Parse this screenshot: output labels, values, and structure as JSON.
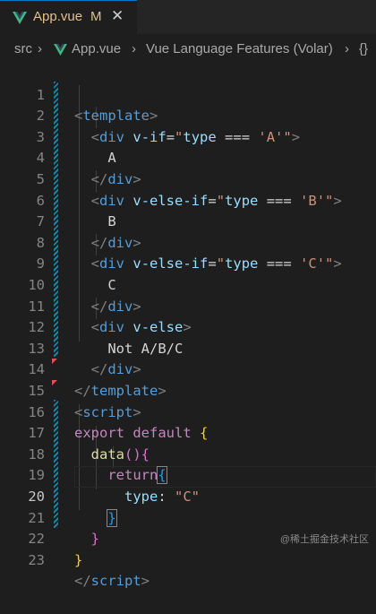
{
  "tab": {
    "title": "App.vue",
    "modified": "M",
    "close": "✕"
  },
  "breadcrumb": {
    "folder": "src",
    "file": "App.vue",
    "provider": "Vue Language Features (Volar)",
    "symbol": "{}"
  },
  "lines": [
    {
      "n": "1"
    },
    {
      "n": "2"
    },
    {
      "n": "3"
    },
    {
      "n": "4"
    },
    {
      "n": "5"
    },
    {
      "n": "6"
    },
    {
      "n": "7"
    },
    {
      "n": "8"
    },
    {
      "n": "9"
    },
    {
      "n": "10"
    },
    {
      "n": "11"
    },
    {
      "n": "12"
    },
    {
      "n": "13"
    },
    {
      "n": "14"
    },
    {
      "n": "15"
    },
    {
      "n": "16"
    },
    {
      "n": "17"
    },
    {
      "n": "18"
    },
    {
      "n": "19"
    },
    {
      "n": "20"
    },
    {
      "n": "21"
    },
    {
      "n": "22"
    },
    {
      "n": "23"
    }
  ],
  "code": {
    "l1": "template",
    "div": "div",
    "vif": "v-if",
    "velseif": "v-else-if",
    "velse": "v-else",
    "type": "type",
    "eq": " === ",
    "a": "'A'",
    "b": "'B'",
    "c": "'C'",
    "textA": "A",
    "textB": "B",
    "textC": "C",
    "textNot": "Not A/B/C",
    "script": "script",
    "export": "export",
    "default": "default",
    "data": "data",
    "return": "return",
    "typeKey": "type",
    "typeVal": "\"C\""
  },
  "watermark": "@稀土掘金技术社区",
  "colors": {
    "accent": "#007acc",
    "background": "#1e1e1e",
    "modified": "#e2c08d",
    "vue": "#41b883"
  }
}
